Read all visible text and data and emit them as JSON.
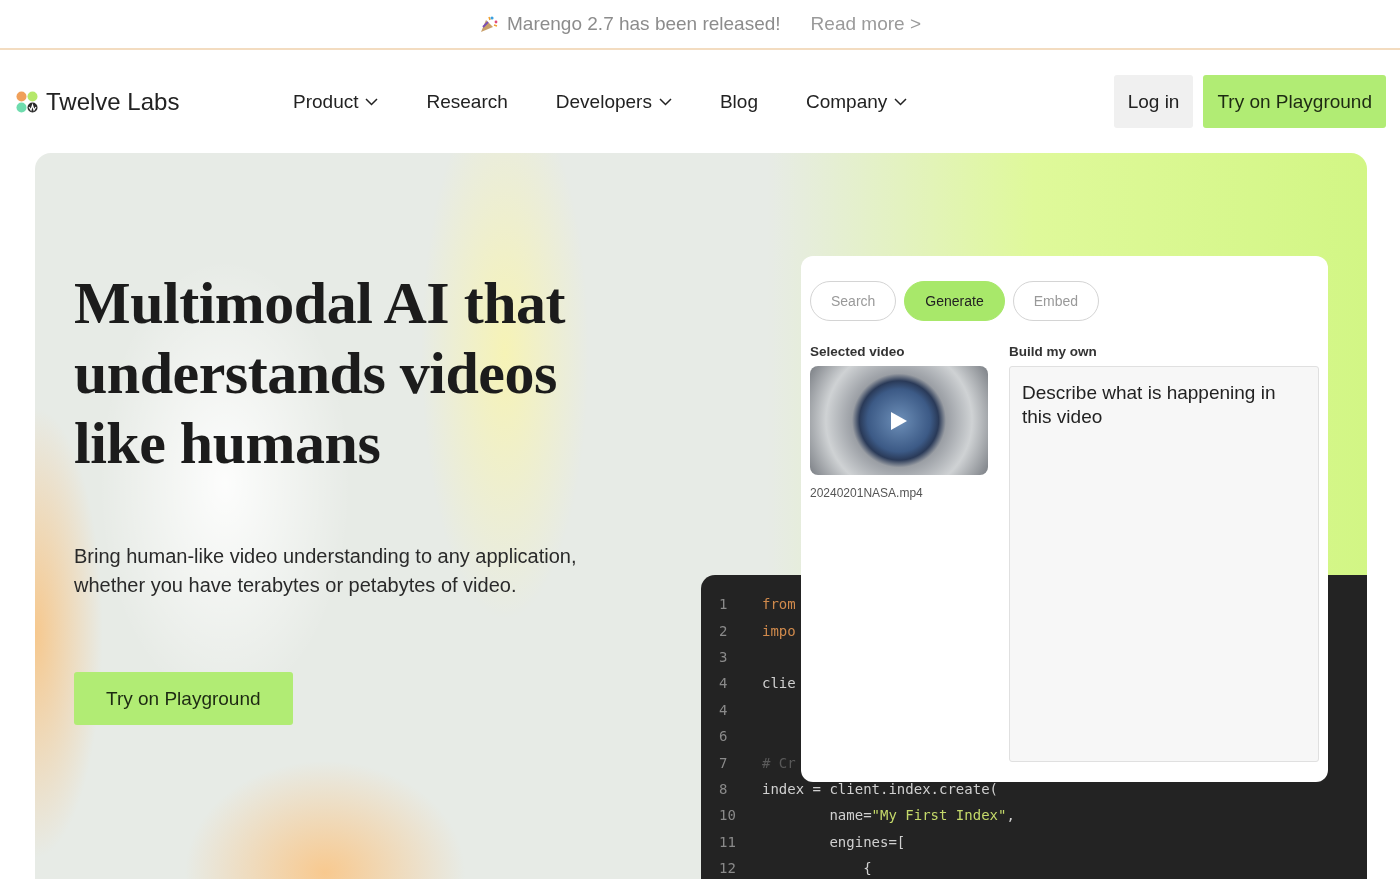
{
  "announcement": {
    "message": "Marengo 2.7 has been released!",
    "link": "Read more >"
  },
  "nav": {
    "brand": "Twelve Labs",
    "items": [
      {
        "label": "Product",
        "dropdown": true
      },
      {
        "label": "Research",
        "dropdown": false
      },
      {
        "label": "Developers",
        "dropdown": true
      },
      {
        "label": "Blog",
        "dropdown": false
      },
      {
        "label": "Company",
        "dropdown": true
      }
    ],
    "login": "Log in",
    "cta": "Try on Playground"
  },
  "hero": {
    "title": [
      "Multimodal AI that",
      "understands videos",
      "like humans"
    ],
    "subtitle": "Bring human-like video understanding to any application, whether you have terabytes or petabytes of video.",
    "cta": "Try on Playground"
  },
  "demo": {
    "tabs": [
      {
        "label": "Search",
        "selected": false
      },
      {
        "label": "Generate",
        "selected": true
      },
      {
        "label": "Embed",
        "selected": false
      }
    ],
    "selected_video_label": "Selected video",
    "video_filename": "20240201NASA.mp4",
    "prompt_label": "Build my own",
    "prompt_value": "Describe what is happening in this video"
  },
  "code": {
    "lines": [
      {
        "number": "1",
        "tokens": [
          {
            "kind": "keyword",
            "text": "from"
          }
        ]
      },
      {
        "number": "2",
        "tokens": [
          {
            "kind": "keyword",
            "text": "impo"
          }
        ]
      },
      {
        "number": "3"
      },
      {
        "number": "4",
        "tokens": [
          {
            "kind": "plain",
            "text": "clie"
          }
        ]
      },
      {
        "number": "4"
      },
      {
        "number": "6"
      },
      {
        "number": "7",
        "tokens": [
          {
            "kind": "comment",
            "text": "# Cr"
          }
        ]
      },
      {
        "number": "8",
        "tokens": [
          {
            "kind": "plain",
            "text": "index = client.index.create("
          }
        ]
      },
      {
        "number": "10",
        "tokens": [
          {
            "kind": "plain",
            "text": "        name="
          },
          {
            "kind": "string",
            "text": "\"My First Index\""
          },
          {
            "kind": "plain",
            "text": ","
          }
        ]
      },
      {
        "number": "11",
        "tokens": [
          {
            "kind": "plain",
            "text": "        engines=["
          }
        ]
      },
      {
        "number": "12",
        "tokens": [
          {
            "kind": "plain",
            "text": "            {"
          }
        ]
      }
    ]
  }
}
